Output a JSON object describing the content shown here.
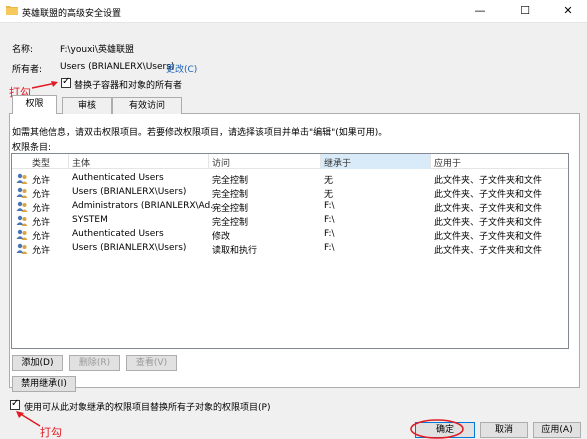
{
  "window": {
    "title": "英雄联盟的高级安全设置",
    "minimize": "—",
    "maximize": "☐",
    "close": "✕"
  },
  "info": {
    "name_label": "名称:",
    "name_value": "F:\\youxi\\英雄联盟",
    "owner_label": "所有者:",
    "owner_value": "Users (BRIANLERX\\Users)",
    "change_link": "更改(C)",
    "replace_owner_label": "替换子容器和对象的所有者",
    "replace_owner_checked": true
  },
  "annotations": {
    "top": "打勾",
    "bottom": "打勾",
    "color": "#e01b24"
  },
  "tabs": [
    {
      "label": "权限",
      "active": true
    },
    {
      "label": "审核",
      "active": false
    },
    {
      "label": "有效访问",
      "active": false
    }
  ],
  "permissions": {
    "instructions": "如需其他信息，请双击权限项目。若要修改权限项目，请选择该项目并单击\"编辑\"(如果可用)。",
    "entries_label": "权限条目:",
    "columns": [
      "类型",
      "主体",
      "访问",
      "继承于",
      "应用于"
    ],
    "rows": [
      [
        "允许",
        "Authenticated Users",
        "完全控制",
        "无",
        "此文件夹、子文件夹和文件"
      ],
      [
        "允许",
        "Users (BRIANLERX\\Users)",
        "完全控制",
        "无",
        "此文件夹、子文件夹和文件"
      ],
      [
        "允许",
        "Administrators (BRIANLERX\\Ad...",
        "完全控制",
        "F:\\",
        "此文件夹、子文件夹和文件"
      ],
      [
        "允许",
        "SYSTEM",
        "完全控制",
        "F:\\",
        "此文件夹、子文件夹和文件"
      ],
      [
        "允许",
        "Authenticated Users",
        "修改",
        "F:\\",
        "此文件夹、子文件夹和文件"
      ],
      [
        "允许",
        "Users (BRIANLERX\\Users)",
        "读取和执行",
        "F:\\",
        "此文件夹、子文件夹和文件"
      ]
    ]
  },
  "buttons": {
    "add": "添加(D)",
    "remove": "删除(R)",
    "view": "查看(V)",
    "disable_inheritance": "禁用继承(I)",
    "ok": "确定",
    "cancel": "取消",
    "apply": "应用(A)"
  },
  "replace_child": {
    "label": "使用可从此对象继承的权限项目替换所有子对象的权限项目(P)",
    "checked": true
  }
}
